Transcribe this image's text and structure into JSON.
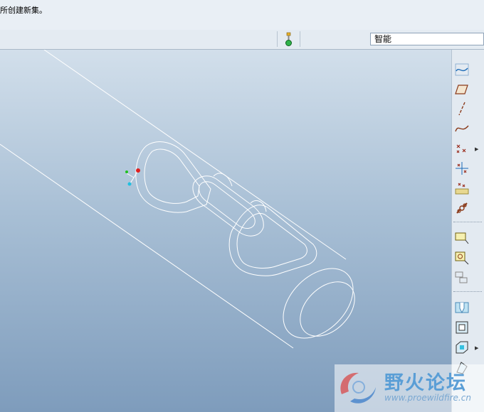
{
  "message": {
    "text": "所创建新集。"
  },
  "filter": {
    "value": "智能"
  },
  "icons": {
    "status_light": "traffic-light-icon",
    "right_toolbar": [
      "sketched-datum-curve-icon",
      "datum-plane-icon",
      "datum-axis-icon",
      "datum-curve-icon",
      "datum-point-icon",
      "datum-point-offset-icon",
      "datum-point-field-icon",
      "coordinate-system-icon",
      "annotation-icon",
      "annotation-element-icon",
      "annotation-link-icon",
      "hole-icon",
      "shell-icon",
      "extrude-surface-icon",
      "draft-icon"
    ]
  },
  "watermark": {
    "title": "野火论坛",
    "url": "www.proewildfire.cn"
  }
}
